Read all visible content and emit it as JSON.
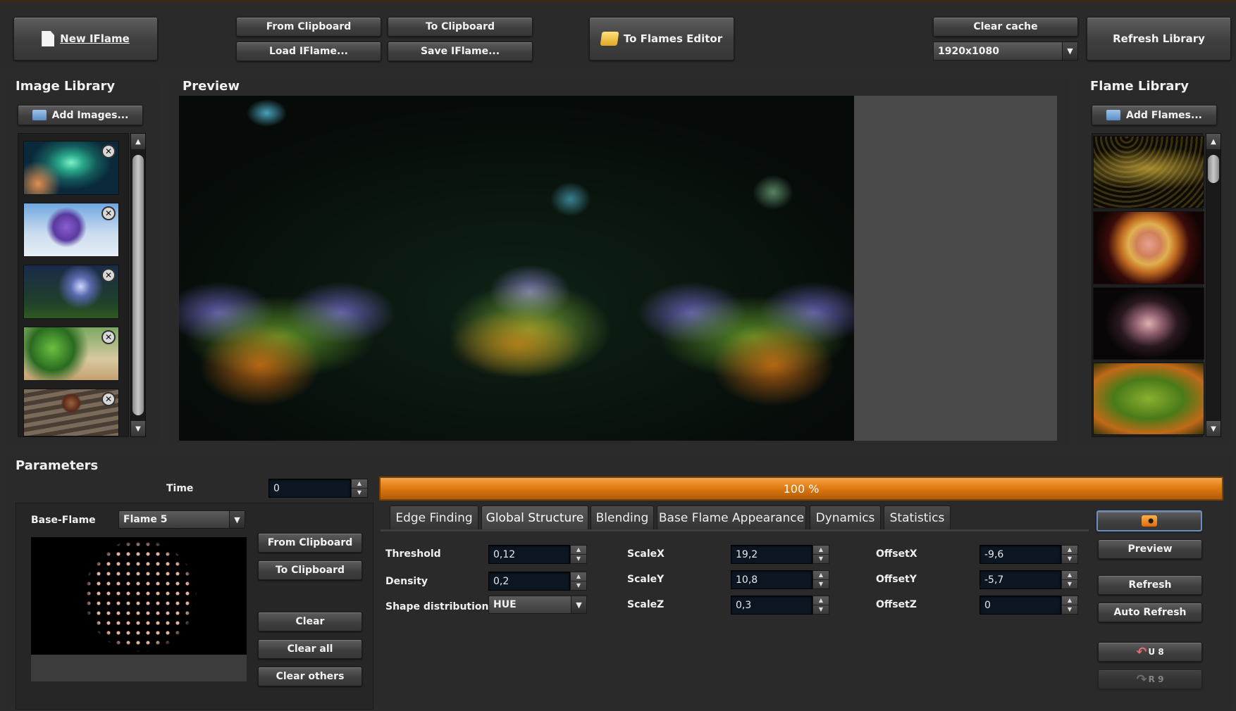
{
  "toolbar": {
    "new_iflame": "New IFlame",
    "from_clipboard": "From Clipboard",
    "to_clipboard": "To Clipboard",
    "load_iflame": "Load IFlame...",
    "save_iflame": "Save IFlame...",
    "to_flames_editor": "To Flames Editor",
    "clear_cache": "Clear cache",
    "resolution": "1920x1080",
    "refresh_library": "Refresh Library"
  },
  "image_library": {
    "title": "Image Library",
    "add_images": "Add Images...",
    "remove_glyph": "✕"
  },
  "preview": {
    "title": "Preview"
  },
  "flame_library": {
    "title": "Flame Library",
    "add_flames": "Add Flames..."
  },
  "parameters": {
    "title": "Parameters",
    "time_label": "Time",
    "time_value": "0",
    "progress_text": "100 %",
    "progress_value": 1.0,
    "base_flame_label": "Base-Flame",
    "base_flame_value": "Flame 5",
    "from_clipboard": "From Clipboard",
    "to_clipboard": "To Clipboard",
    "clear": "Clear",
    "clear_all": "Clear all",
    "clear_others": "Clear others"
  },
  "tabs": [
    "Edge Finding",
    "Global Structure",
    "Blending",
    "Base Flame Appearance",
    "Dynamics",
    "Statistics"
  ],
  "active_tab": "Global Structure",
  "global_structure": {
    "threshold_label": "Threshold",
    "threshold_value": "0,12",
    "density_label": "Density",
    "density_value": "0,2",
    "shape_label": "Shape distribution",
    "shape_value": "HUE",
    "scalex_label": "ScaleX",
    "scalex_value": "19,2",
    "scaley_label": "ScaleY",
    "scaley_value": "10,8",
    "scalez_label": "ScaleZ",
    "scalez_value": "0,3",
    "offsetx_label": "OffsetX",
    "offsetx_value": "-9,6",
    "offsety_label": "OffsetY",
    "offsety_value": "-5,7",
    "offsetz_label": "OffsetZ",
    "offsetz_value": "0"
  },
  "right_actions": {
    "preview": "Preview",
    "refresh": "Refresh",
    "auto_refresh": "Auto Refresh",
    "undo": "U 8",
    "redo": "R 9"
  },
  "colors": {
    "progress_orange": "#e07c12",
    "field_bg": "#0c1622",
    "accent_blue": "#6b8fc4"
  }
}
